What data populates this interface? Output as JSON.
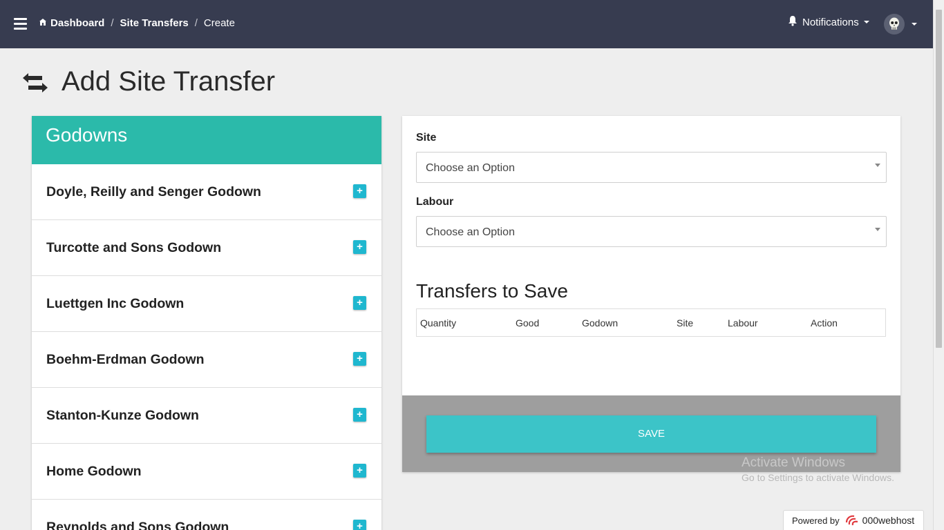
{
  "navbar": {
    "breadcrumbs": [
      "Dashboard",
      "Site Transfers",
      "Create"
    ],
    "notifications_label": "Notifications"
  },
  "page": {
    "title": "Add Site Transfer"
  },
  "godowns": {
    "header": "Godowns",
    "items": [
      {
        "name": "Doyle, Reilly and Senger Godown"
      },
      {
        "name": "Turcotte and Sons Godown"
      },
      {
        "name": "Luettgen Inc Godown"
      },
      {
        "name": "Boehm-Erdman Godown"
      },
      {
        "name": "Stanton-Kunze Godown"
      },
      {
        "name": "Home Godown"
      },
      {
        "name": "Reynolds and Sons Godown"
      }
    ],
    "add_label": "+"
  },
  "form": {
    "site_label": "Site",
    "site_value": "Choose an Option",
    "labour_label": "Labour",
    "labour_value": "Choose an Option",
    "transfers_title": "Transfers to Save",
    "columns": [
      "Quantity",
      "Good",
      "Godown",
      "Site",
      "Labour",
      "Action"
    ],
    "save_label": "SAVE"
  },
  "watermark": {
    "line1": "Activate Windows",
    "line2": "Go to Settings to activate Windows."
  },
  "badge": {
    "prefix": "Powered by",
    "brand": "000webhost"
  },
  "colors": {
    "navbar": "#373c50",
    "teal_header": "#2bbaaa",
    "add_button": "#1fb7cf",
    "save_button": "#3cc4c8",
    "save_area": "#9e9e9e"
  }
}
